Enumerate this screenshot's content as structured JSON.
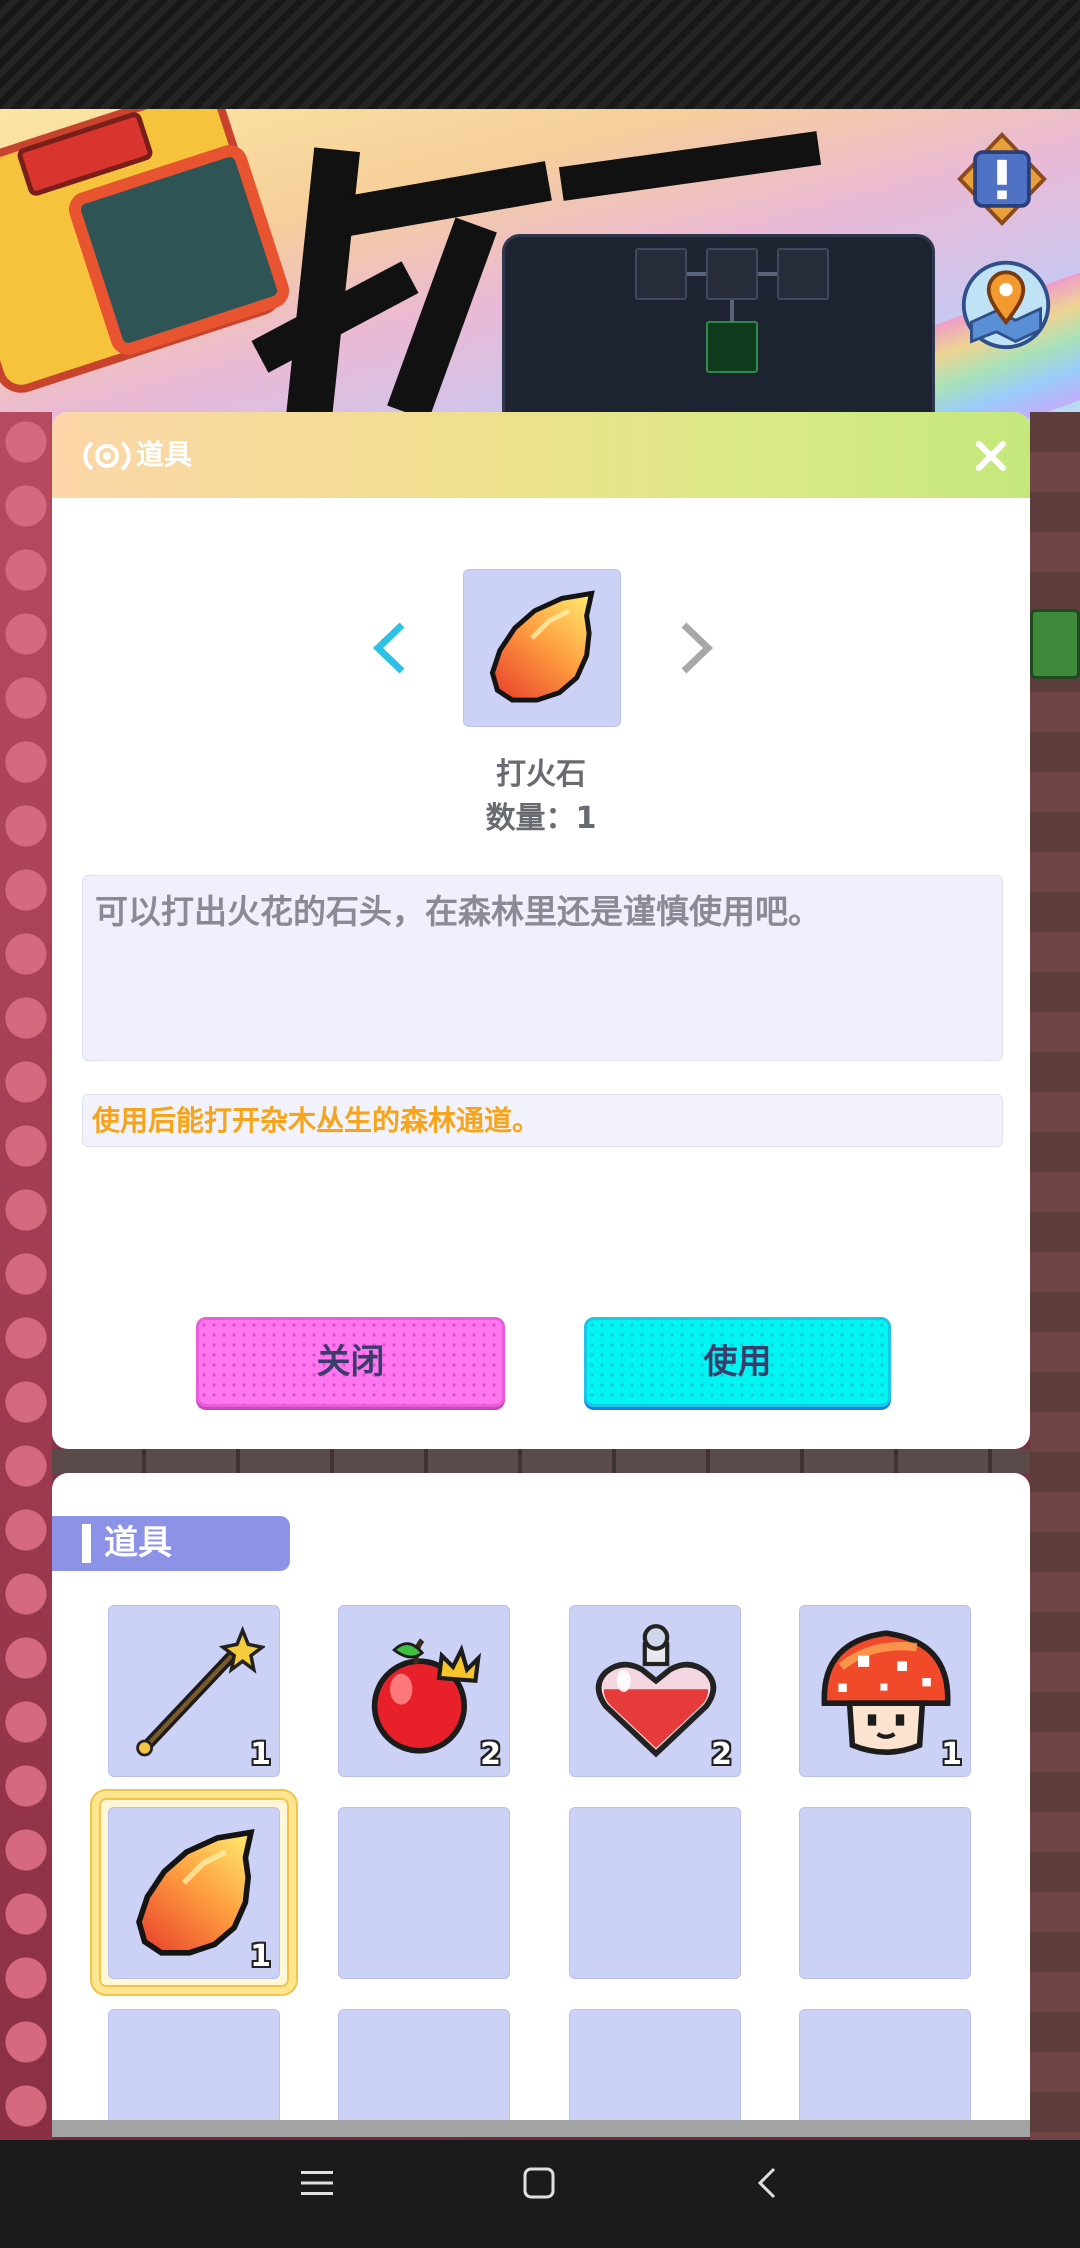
{
  "modal": {
    "title": "道具",
    "title_icon": "radar-icon",
    "close_icon": "close-icon",
    "prev_icon": "chevron-left-icon",
    "next_icon": "chevron-right-icon",
    "item": {
      "name": "打火石",
      "quantity_label": "数量：",
      "quantity": "1",
      "icon": "flint-stone-icon"
    },
    "description": "可以打出火花的石头，在森林里还是谨慎使用吧。",
    "hint": "使用后能打开杂木丛生的森林通道。",
    "buttons": {
      "close": "关闭",
      "use": "使用"
    }
  },
  "inventory": {
    "title": "道具",
    "selected_index": 4,
    "items": [
      {
        "icon": "golden-staff-icon",
        "count": "1"
      },
      {
        "icon": "crowned-apple-icon",
        "count": "2"
      },
      {
        "icon": "heart-potion-icon",
        "count": "2"
      },
      {
        "icon": "mushroom-icon",
        "count": "1"
      },
      {
        "icon": "flint-stone-icon",
        "count": "1"
      },
      {
        "icon": "",
        "count": ""
      },
      {
        "icon": "",
        "count": ""
      },
      {
        "icon": "",
        "count": ""
      },
      {
        "icon": "",
        "count": ""
      },
      {
        "icon": "",
        "count": ""
      },
      {
        "icon": "",
        "count": ""
      },
      {
        "icon": "",
        "count": ""
      }
    ]
  },
  "hud": {
    "alert_icon": "alert-badge-icon",
    "map_icon": "map-marker-icon"
  },
  "nav_bar": {
    "menu_icon": "menu-icon",
    "home_icon": "home-square-icon",
    "back_icon": "back-chevron-icon"
  },
  "colors": {
    "header_gradient_start": "#fcd6a8",
    "header_gradient_end": "#c4e87c",
    "item_slot": "#ccd2f6",
    "description_bg": "#eff0fb",
    "hint_text": "#f5a41c",
    "close_button": "#ff76ee",
    "use_button": "#00f5f3",
    "inventory_tab": "#8c93e6",
    "selected_ring": "#ffe58f",
    "prev_arrow": "#2ec1e6",
    "next_arrow": "#a8a8a8"
  }
}
